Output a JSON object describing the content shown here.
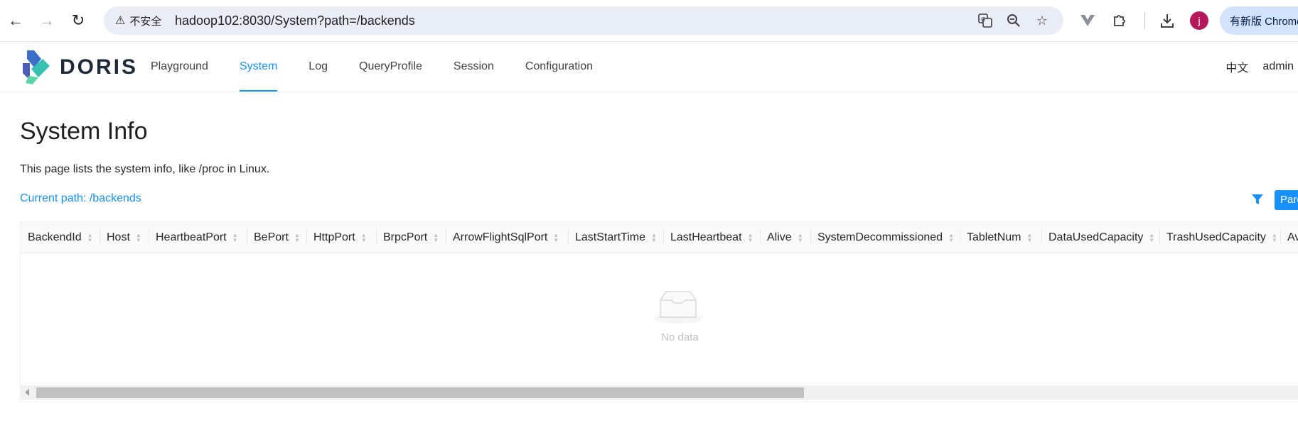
{
  "browser": {
    "security_label": "不安全",
    "url": "hadoop102:8030/System?path=/backends",
    "profile_initial": "j",
    "update_label": "有新版 Chrome"
  },
  "app": {
    "logo_text": "DORIS",
    "nav": [
      {
        "label": "Playground",
        "active": false
      },
      {
        "label": "System",
        "active": true
      },
      {
        "label": "Log",
        "active": false
      },
      {
        "label": "QueryProfile",
        "active": false
      },
      {
        "label": "Session",
        "active": false
      },
      {
        "label": "Configuration",
        "active": false
      }
    ],
    "language": "中文",
    "user": "admin"
  },
  "page": {
    "title": "System Info",
    "description": "This page lists the system info, like /proc in Linux.",
    "current_path": "Current path: /backends",
    "parent_button": "Parent"
  },
  "table": {
    "columns": [
      "BackendId",
      "Host",
      "HeartbeatPort",
      "BePort",
      "HttpPort",
      "BrpcPort",
      "ArrowFlightSqlPort",
      "LastStartTime",
      "LastHeartbeat",
      "Alive",
      "SystemDecommissioned",
      "TabletNum",
      "DataUsedCapacity",
      "TrashUsedCapacity",
      "Av"
    ],
    "empty_text": "No data"
  },
  "colors": {
    "accent": "#1890ff",
    "doris_teal": "#36c1b2",
    "doris_blue": "#3a6ec9"
  }
}
